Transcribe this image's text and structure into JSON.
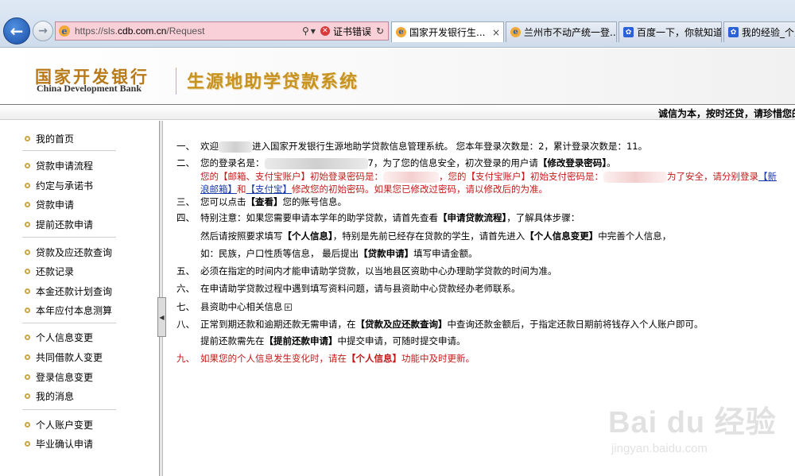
{
  "browser": {
    "url_prefix": "https://sls.",
    "url_domain": "cdb.com.cn",
    "url_path": "/Request",
    "cert_error": "证书错误",
    "tabs": [
      {
        "label": "国家开发银行生..."
      },
      {
        "label": "兰州市不动产统一登..."
      },
      {
        "label": "百度一下，你就知道"
      },
      {
        "label": "我的经验_个人"
      }
    ]
  },
  "header": {
    "bank_name_cn": "国家开发银行",
    "bank_name_en": "China Development Bank",
    "system_title": "生源地助学贷款系统",
    "slogan": "诚信为本，按时还贷，请珍惜您的"
  },
  "sidebar": {
    "items": [
      {
        "label": "我的首页"
      },
      {
        "label": "贷款申请流程"
      },
      {
        "label": "约定与承诺书"
      },
      {
        "label": "贷款申请"
      },
      {
        "label": "提前还款申请"
      },
      {
        "label": "贷款及应还款查询"
      },
      {
        "label": "还款记录"
      },
      {
        "label": "本金还款计划查询"
      },
      {
        "label": "本年应付本息测算"
      },
      {
        "label": "个人信息变更"
      },
      {
        "label": "共同借款人变更"
      },
      {
        "label": "登录信息变更"
      },
      {
        "label": "我的消息"
      },
      {
        "label": "个人账户变更"
      },
      {
        "label": "毕业确认申请"
      }
    ]
  },
  "main": {
    "n1": "一、",
    "l1a": "欢迎",
    "l1b": "进入国家开发银行生源地助学贷款信息管理系统。 您本年登录次数是：2，累计登录次数是：11。",
    "n2": "二、",
    "l2a": "您的登录名是：",
    "l2b": "7，为了您的信息安全，初次登录的用户请",
    "l2c": "【修改登录密码】",
    "l2d": "。",
    "l2e_1": "您的【邮箱、支付宝账户】初始登录密码是：",
    "l2e_2": "，您的【支付宝账户】初始支付密码是：",
    "l2e_3": "为了安全，请分别登录",
    "l2e_link": "【新",
    "l2f_link1": "浪邮箱】",
    "l2f_2": "和",
    "l2f_link2": "【支付宝】",
    "l2f_3": "修改您的初始密码。如果您已修改过密码，请以修改后的为准。",
    "n3": "三、",
    "l3a": "您可以点击",
    "l3b": "【查看】",
    "l3c": "您的账号信息。",
    "n4": "四、",
    "l4a": "特别注意：如果您需要申请本学年的助学贷款，请首先查看",
    "l4b": "【申请贷款流程】",
    "l4c": "，了解具体步骤：",
    "l4d_1": "然后请按照要求填写",
    "l4d_2": "【个人信息】",
    "l4d_3": "，特别是先前已经存在贷款的学生，请首先进入",
    "l4d_4": "【个人信息变更】",
    "l4d_5": "中完善个人信息，",
    "l4e_1": "如：民族，户口性质等信息， 最后提出",
    "l4e_2": "【贷款申请】",
    "l4e_3": "填写申请金额。",
    "n5": "五、",
    "l5": "必须在指定的时间内才能申请助学贷款，以当地县区资助中心办理助学贷款的时间为准。",
    "n6": "六、",
    "l6": "在申请助学贷款过程中遇到填写资料问题，请与县资助中心贷款经办老师联系。",
    "n7": "七、",
    "l7": "县资助中心相关信息",
    "n8": "八、",
    "l8a": "正常到期还款和逾期还款无需申请，在",
    "l8b": "【贷款及应还款查询】",
    "l8c": "中查询还款金额后，于指定还款日期前将钱存入个人账户即可。",
    "l8d_1": "提前还款需先在",
    "l8d_2": "【提前还款申请】",
    "l8d_3": "中提交申请，可随时提交申请。",
    "n9": "九、",
    "l9a": "如果您的个人信息发生变化时，请在",
    "l9b": "【个人信息】",
    "l9c": "功能中及时更新。"
  },
  "watermark": {
    "logo": "Bai du 经验",
    "sub": "jingyan.baidu.com"
  }
}
